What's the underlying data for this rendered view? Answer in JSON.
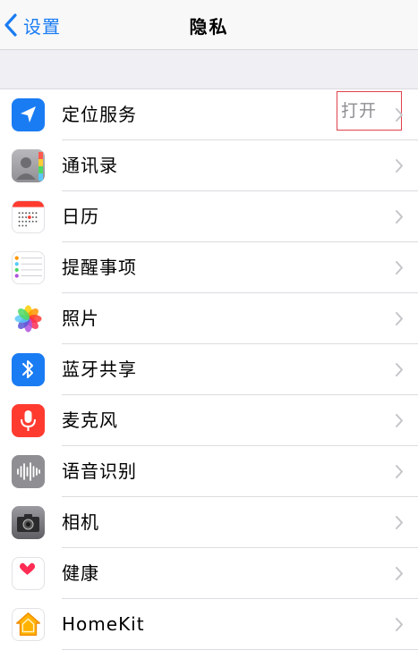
{
  "nav": {
    "back_label": "设置",
    "title": "隐私"
  },
  "rows": [
    {
      "label": "定位服务",
      "value": "打开",
      "icon": "location-arrow-icon"
    },
    {
      "label": "通讯录",
      "icon": "contacts-icon"
    },
    {
      "label": "日历",
      "icon": "calendar-icon"
    },
    {
      "label": "提醒事项",
      "icon": "reminders-icon"
    },
    {
      "label": "照片",
      "icon": "photos-icon"
    },
    {
      "label": "蓝牙共享",
      "icon": "bluetooth-icon"
    },
    {
      "label": "麦克风",
      "icon": "microphone-icon"
    },
    {
      "label": "语音识别",
      "icon": "speech-recognition-icon"
    },
    {
      "label": "相机",
      "icon": "camera-icon"
    },
    {
      "label": "健康",
      "icon": "health-heart-icon"
    },
    {
      "label": "HomeKit",
      "icon": "homekit-icon"
    }
  ],
  "colors": {
    "accent": "#1a7cf3",
    "highlight_border": "#e0424a"
  }
}
